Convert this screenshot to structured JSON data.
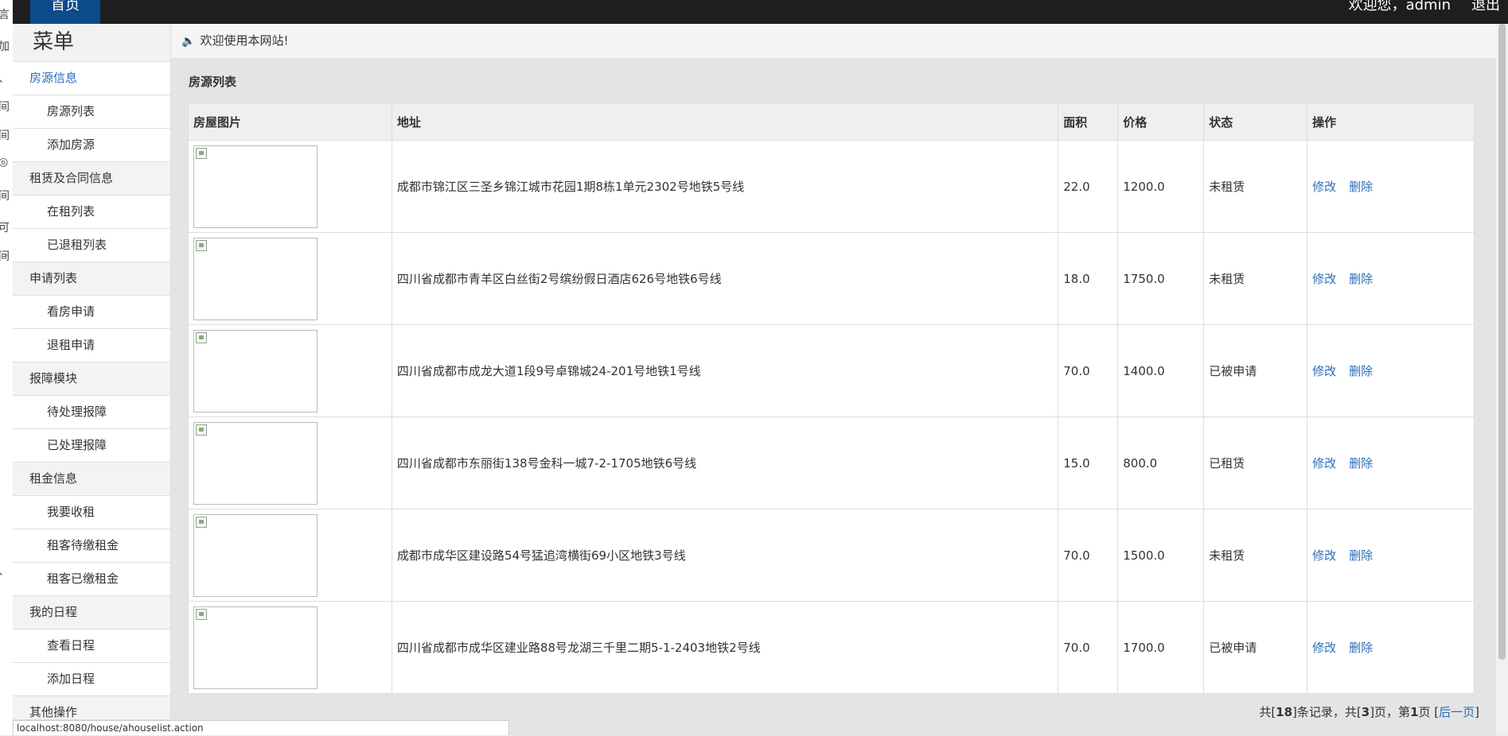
{
  "topbar": {
    "home_label": "首页",
    "welcome": "欢迎您，admin",
    "logout": "退出"
  },
  "left_strip": [
    "言",
    "加",
    "、",
    "间",
    "间",
    "◎",
    "间",
    "可",
    "间",
    "、"
  ],
  "left_strip_marker": "*",
  "sidebar": {
    "title": "菜单",
    "items": [
      {
        "label": "房源信息",
        "type": "section",
        "active": true
      },
      {
        "label": "房源列表",
        "type": "sub"
      },
      {
        "label": "添加房源",
        "type": "sub"
      },
      {
        "label": "租赁及合同信息",
        "type": "section"
      },
      {
        "label": "在租列表",
        "type": "sub"
      },
      {
        "label": "已退租列表",
        "type": "sub"
      },
      {
        "label": "申请列表",
        "type": "section"
      },
      {
        "label": "看房申请",
        "type": "sub"
      },
      {
        "label": "退租申请",
        "type": "sub"
      },
      {
        "label": "报障模块",
        "type": "section"
      },
      {
        "label": "待处理报障",
        "type": "sub"
      },
      {
        "label": "已处理报障",
        "type": "sub"
      },
      {
        "label": "租金信息",
        "type": "section"
      },
      {
        "label": "我要收租",
        "type": "sub"
      },
      {
        "label": "租客待缴租金",
        "type": "sub"
      },
      {
        "label": "租客已缴租金",
        "type": "sub"
      },
      {
        "label": "我的日程",
        "type": "section"
      },
      {
        "label": "查看日程",
        "type": "sub"
      },
      {
        "label": "添加日程",
        "type": "sub"
      },
      {
        "label": "其他操作",
        "type": "section"
      }
    ]
  },
  "notice": "欢迎使用本网站!",
  "panel_title": "房源列表",
  "table": {
    "headers": [
      "房屋图片",
      "地址",
      "面积",
      "价格",
      "状态",
      "操作"
    ],
    "rows": [
      {
        "address": "成都市锦江区三圣乡锦江城市花园1期8栋1单元2302号地铁5号线",
        "area": "22.0",
        "price": "1200.0",
        "status": "未租赁"
      },
      {
        "address": "四川省成都市青羊区白丝街2号缤纷假日酒店626号地铁6号线",
        "area": "18.0",
        "price": "1750.0",
        "status": "未租赁"
      },
      {
        "address": "四川省成都市成龙大道1段9号卓锦城24-201号地铁1号线",
        "area": "70.0",
        "price": "1400.0",
        "status": "已被申请"
      },
      {
        "address": "四川省成都市东丽街138号金科一城7-2-1705地铁6号线",
        "area": "15.0",
        "price": "800.0",
        "status": "已租赁"
      },
      {
        "address": "成都市成华区建设路54号猛追湾横街69小区地铁3号线",
        "area": "70.0",
        "price": "1500.0",
        "status": "未租赁"
      },
      {
        "address": "四川省成都市成华区建业路88号龙湖三千里二期5-1-2403地铁2号线",
        "area": "70.0",
        "price": "1700.0",
        "status": "已被申请"
      }
    ],
    "edit_label": "修改",
    "delete_label": "删除"
  },
  "pager": {
    "prefix": "共[",
    "records": "18",
    "mid1": "]条记录，共[",
    "pages": "3",
    "mid2": "]页，第",
    "current": "1",
    "mid3": "页 [",
    "next_label": "后一页",
    "suffix": "]"
  },
  "status_url": "localhost:8080/house/ahouselist.action"
}
